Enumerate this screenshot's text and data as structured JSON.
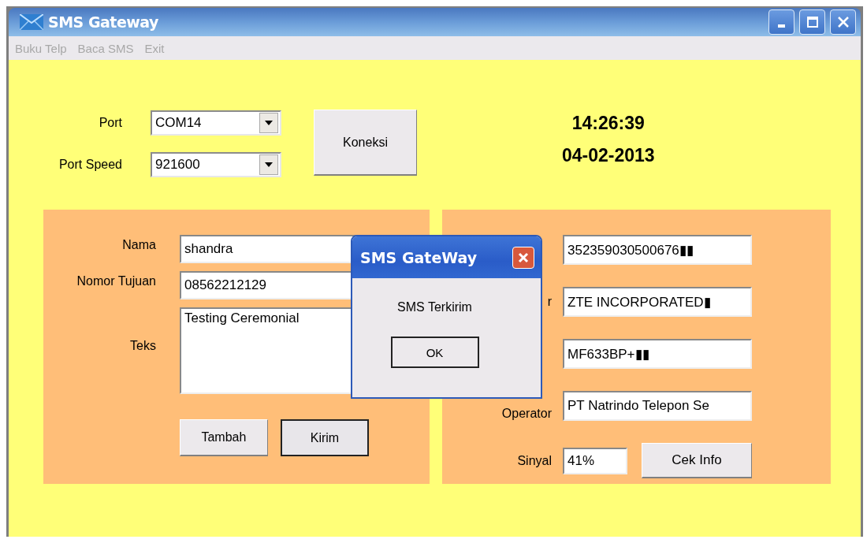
{
  "window": {
    "title": "SMS Gateway"
  },
  "menu": [
    {
      "label": "Buku Telp"
    },
    {
      "label": "Baca SMS"
    },
    {
      "label": "Exit"
    }
  ],
  "connection": {
    "fields": [
      {
        "label": "Port",
        "value": "COM14"
      },
      {
        "label": "Port Speed",
        "value": "921600"
      }
    ],
    "button": "Koneksi"
  },
  "clock": {
    "time": "14:26:39",
    "date": "04-02-2013"
  },
  "message_panel": {
    "fields": [
      {
        "label": "Nama",
        "value": "shandra",
        "kind": "line"
      },
      {
        "label": "Nomor Tujuan",
        "value": "08562212129",
        "kind": "line"
      },
      {
        "label": "Teks",
        "value": "Testing Ceremonial",
        "kind": "area"
      }
    ],
    "buttons": [
      {
        "label": "Tambah",
        "focused": false
      },
      {
        "label": "Kirim",
        "focused": true
      }
    ]
  },
  "info_panel": {
    "fields": [
      {
        "value": "352359030500676▮▮"
      },
      {
        "label": "r",
        "value": "ZTE INCORPORATED▮"
      },
      {
        "value": "MF633BP+▮▮"
      },
      {
        "label": "Operator",
        "value": "PT Natrindo Telepon Se"
      }
    ],
    "signal": {
      "label": "Sinyal",
      "value": "41%"
    },
    "button": "Cek Info"
  },
  "dialog": {
    "title": "SMS GateWay",
    "message": "SMS Terkirim",
    "button": "OK"
  }
}
